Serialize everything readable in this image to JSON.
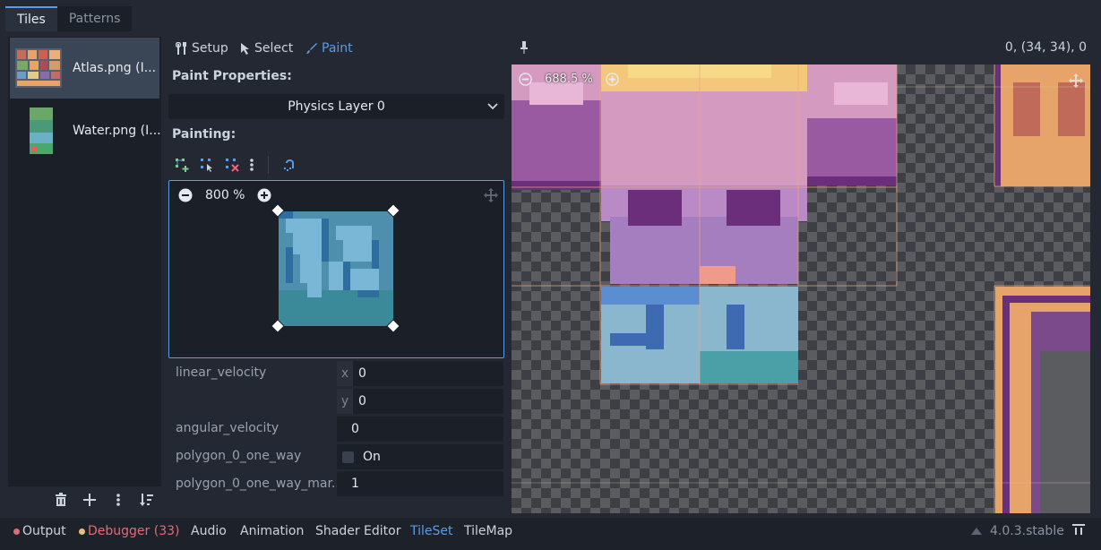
{
  "tabs": [
    {
      "label": "Tiles",
      "active": true
    },
    {
      "label": "Patterns",
      "active": false
    }
  ],
  "sources": [
    {
      "label": "Atlas.png (I...",
      "selected": true
    },
    {
      "label": "Water.png (I...",
      "selected": false
    }
  ],
  "left_buttons": [
    "trash-icon",
    "add-icon",
    "more-icon",
    "sort-icon"
  ],
  "modes": {
    "setup": "Setup",
    "select": "Select",
    "paint": "Paint"
  },
  "paint_properties_label": "Paint Properties:",
  "dropdown_value": "Physics Layer 0",
  "painting_label": "Painting:",
  "editor_zoom": "800 %",
  "viewport_zoom": "688.5 %",
  "coordinates": "0, (34, 34), 0",
  "properties": {
    "linear_velocity": {
      "label": "linear_velocity",
      "x_axis": "x",
      "x": "0",
      "y_axis": "y",
      "y": "0"
    },
    "angular_velocity": {
      "label": "angular_velocity",
      "value": "0"
    },
    "one_way": {
      "label": "polygon_0_one_way",
      "value": "On",
      "checked": false
    },
    "one_way_margin": {
      "label": "polygon_0_one_way_mar...",
      "value": "1"
    }
  },
  "bottom_tabs": {
    "output": "Output",
    "debugger": "Debugger (33)",
    "audio": "Audio",
    "animation": "Animation",
    "shader": "Shader Editor",
    "tileset": "TileSet",
    "tilemap": "TileMap"
  },
  "version": "4.0.3.stable",
  "colors": {
    "accent": "#5b9ce6",
    "error": "#e06c75",
    "warn": "#e5c07b"
  }
}
